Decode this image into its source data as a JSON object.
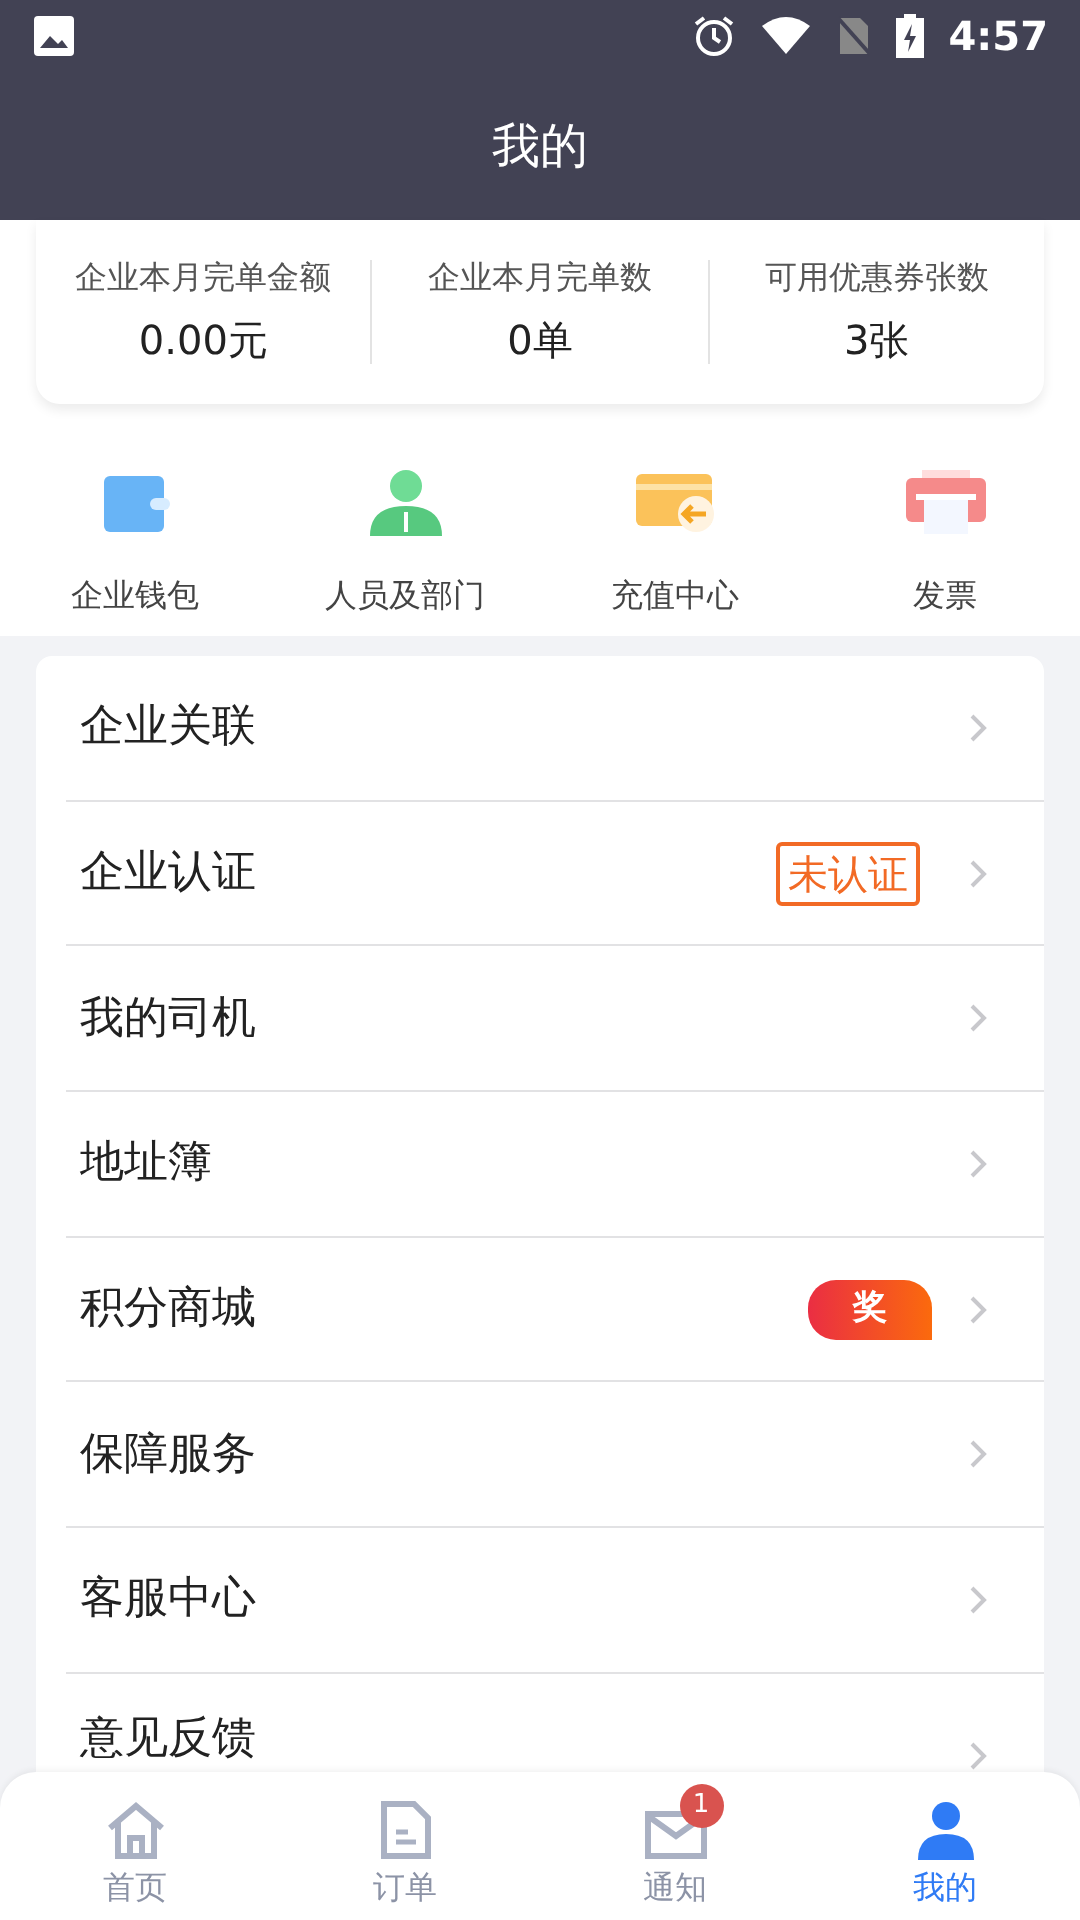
{
  "status_bar": {
    "time": "4:57"
  },
  "header": {
    "title": "我的"
  },
  "stats": [
    {
      "label": "企业本月完单金额",
      "value": "0.00元"
    },
    {
      "label": "企业本月完单数",
      "value": "0单"
    },
    {
      "label": "可用优惠券张数",
      "value": "3张"
    }
  ],
  "shortcuts": [
    {
      "label": "企业钱包",
      "kind": "wallet"
    },
    {
      "label": "人员及部门",
      "kind": "people"
    },
    {
      "label": "充值中心",
      "kind": "recharge"
    },
    {
      "label": "发票",
      "kind": "invoice"
    }
  ],
  "menu": [
    {
      "label": "企业关联",
      "kind": "plain"
    },
    {
      "label": "企业认证",
      "kind": "tag",
      "tag": "未认证"
    },
    {
      "label": "我的司机",
      "kind": "plain"
    },
    {
      "label": "地址簿",
      "kind": "plain"
    },
    {
      "label": "积分商城",
      "kind": "prize",
      "tag": "奖"
    },
    {
      "label": "保障服务",
      "kind": "plain"
    },
    {
      "label": "客服中心",
      "kind": "plain"
    },
    {
      "label": "意见反馈",
      "kind": "plain"
    }
  ],
  "bottom_nav": [
    {
      "label": "首页",
      "kind": "home",
      "selected": false
    },
    {
      "label": "订单",
      "kind": "orders",
      "selected": false
    },
    {
      "label": "通知",
      "kind": "mail",
      "selected": false,
      "badge": "1"
    },
    {
      "label": "我的",
      "kind": "me",
      "selected": true
    }
  ]
}
